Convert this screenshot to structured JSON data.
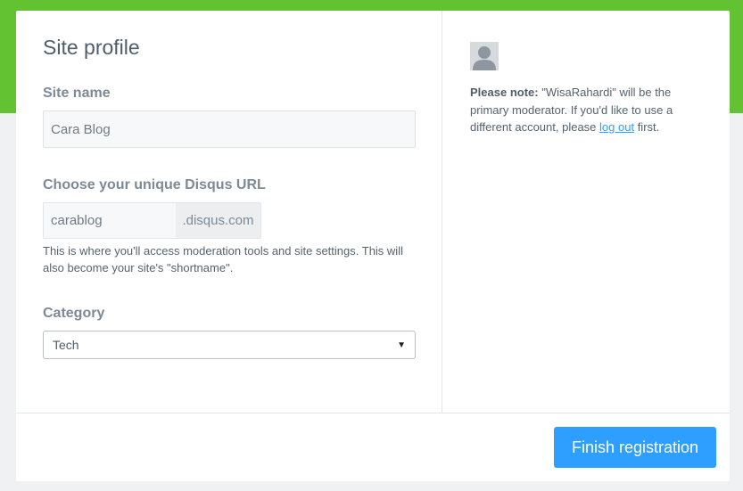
{
  "header": {
    "title": "Site profile"
  },
  "form": {
    "site_name": {
      "label": "Site name",
      "value": "Cara Blog"
    },
    "url": {
      "label": "Choose your unique Disqus URL",
      "value": "carablog",
      "suffix": ".disqus.com",
      "help": "This is where you'll access moderation tools and site settings. This will also become your site's \"shortname\"."
    },
    "category": {
      "label": "Category",
      "selected": "Tech"
    }
  },
  "sidebar": {
    "avatar_icon": "user-avatar-icon",
    "note_bold": "Please note:",
    "note_text": " \"WisaRahardi\" will be the primary moderator. If you'd like to use a different account, please ",
    "logout_link": "log out",
    "note_end": " first."
  },
  "footer": {
    "finish_label": "Finish registration"
  },
  "colors": {
    "brand_green": "#62c231",
    "accent_blue": "#2e9fff",
    "background": "#f0f1f2"
  }
}
